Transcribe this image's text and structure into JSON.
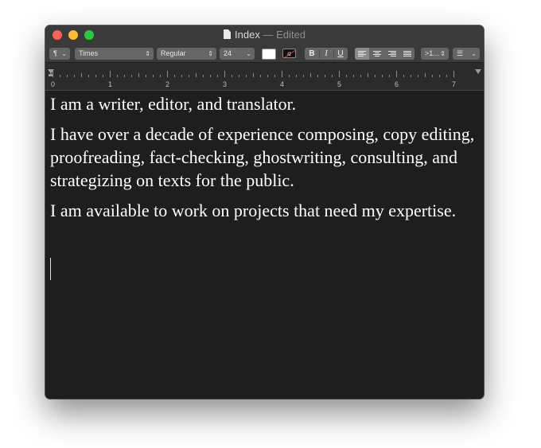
{
  "window": {
    "title": "Index",
    "status": "— Edited"
  },
  "toolbar": {
    "paragraph_style": "¶",
    "font_family": "Times",
    "font_style": "Regular",
    "font_size": "24",
    "bold": "B",
    "italic": "I",
    "underline": "U",
    "spacing": ">1...",
    "list_icon": "list-bullets-icon"
  },
  "ruler": {
    "numbers": [
      "0",
      "1",
      "2",
      "3",
      "4",
      "5",
      "6",
      "7"
    ]
  },
  "document": {
    "paragraphs": [
      "I am a writer, editor, and translator.",
      "I have over a decade of experience composing, copy editing, proofreading, fact-checking, ghostwriting, consulting, and strategizing on texts for the public.",
      "I am available to work on projects that need my expertise."
    ]
  },
  "colors": {
    "text_color": "#ffffff",
    "background": "#1e1e1e"
  }
}
